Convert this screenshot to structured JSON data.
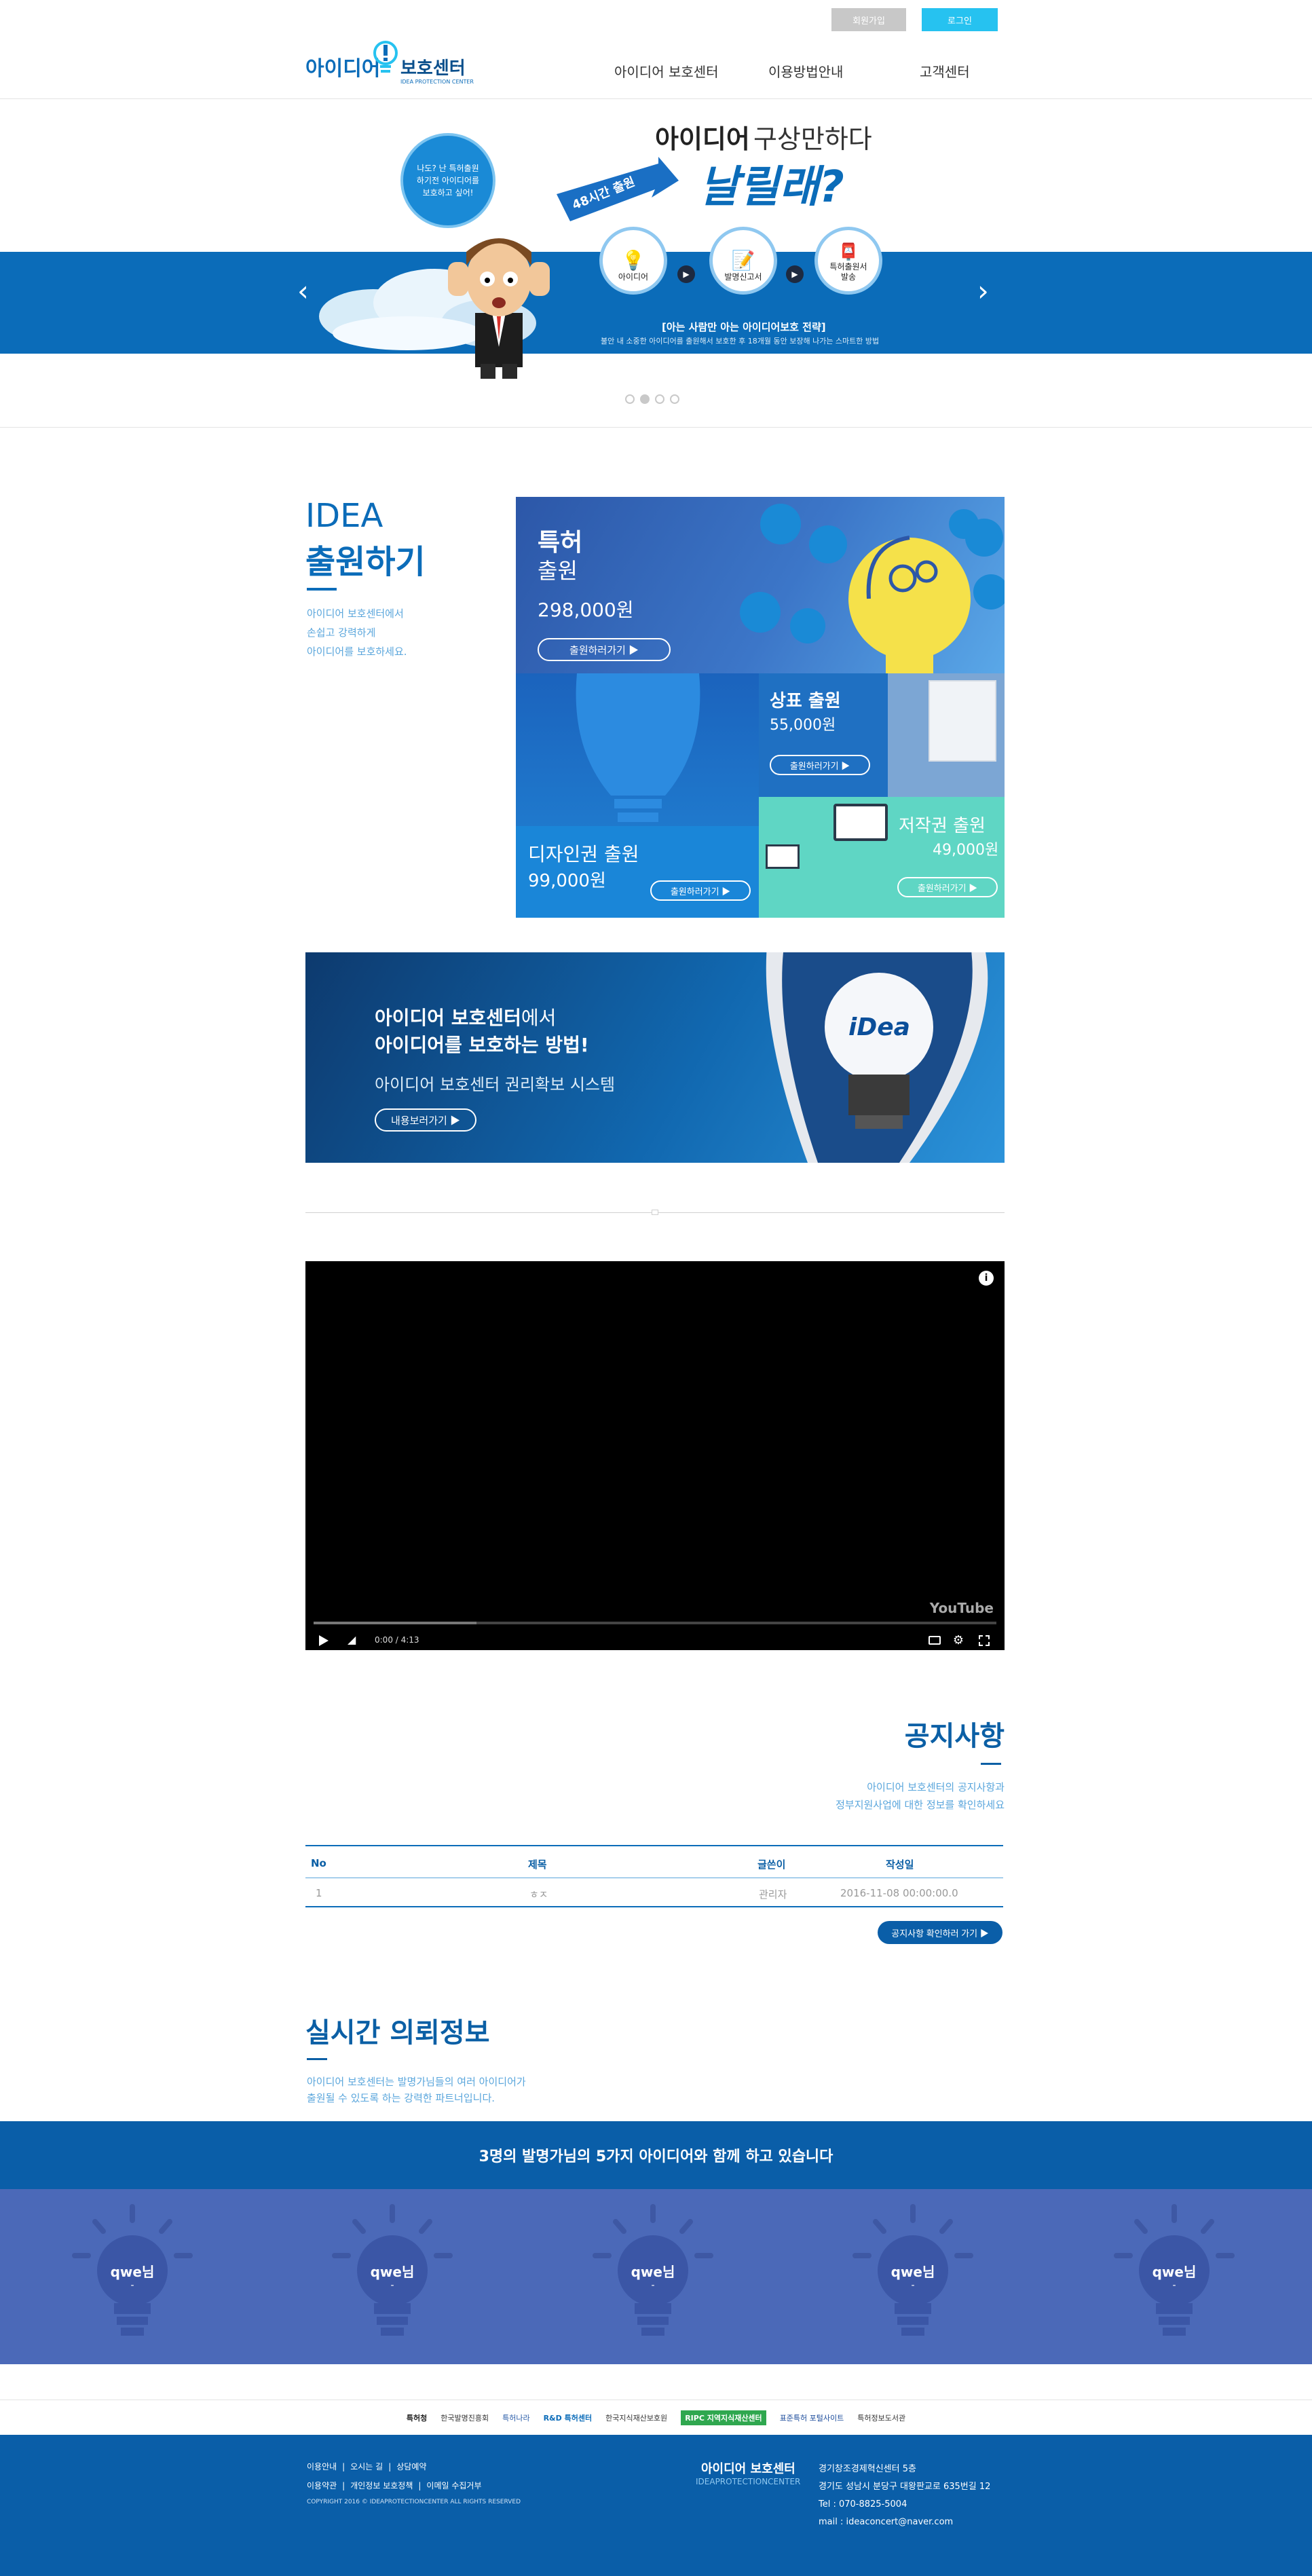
{
  "header": {
    "logo": {
      "main_text": "아이디어",
      "brand_text": "보호센터",
      "sub_text": "IDEA PROTECTION CENTER"
    },
    "signup_label": "회원가입",
    "login_label": "로그인",
    "nav": [
      "아이디어 보호센터",
      "이용방법안내",
      "고객센터"
    ]
  },
  "hero": {
    "headline_bold": "아이디어",
    "headline_rest": "구상만하다",
    "headline_big": "날릴래?",
    "bubble_text": "나도? 난 특허출원하기전 아이디어를 보호하고 싶어!",
    "banner_text": "48시간 출원",
    "steps": [
      "아이디어",
      "발명신고서",
      "특허출원서 발송"
    ],
    "caption_main": "[아는 사람만 아는 아이디어보호 전략]",
    "caption_sub": "불안 내 소중한 아이디어를 출원해서 보호한 후 18개월 동안 보장해 나가는 스마트한 방법",
    "dots_total": 4,
    "dots_active_index": 1,
    "prev_icon": "chevron-left-icon",
    "next_icon": "chevron-right-icon"
  },
  "apply": {
    "heading_en": "IDEA",
    "heading_ko": "출원하기",
    "description": [
      "아이디어 보호센터에서",
      "손쉽고 강력하게",
      "아이디어를 보호하세요."
    ],
    "tiles": {
      "patent": {
        "title": "특허",
        "sub": "출원",
        "price": "298,000원",
        "button": "출원하러가기 ▶"
      },
      "trademark": {
        "title": "상표 출원",
        "price": "55,000원",
        "button": "출원하러가기 ▶"
      },
      "design": {
        "title": "디자인권 출원",
        "price": "99,000원",
        "button": "출원하러가기 ▶"
      },
      "copyright": {
        "title": "저작권 출원",
        "price": "49,000원",
        "button": "출원하러가기 ▶"
      }
    }
  },
  "protect_banner": {
    "line1_bold": "아이디어 보호센터",
    "line1_rest": "에서",
    "line2": "아이디어를 보호하는 방법!",
    "line3": "아이디어 보호센터 권리확보 시스템",
    "button": "내용보러가기 ▶",
    "bulb_text": "iDea"
  },
  "video": {
    "time": "0:00 / 4:13",
    "brand": "YouTube",
    "progress": 0.0
  },
  "notice": {
    "title": "공지사항",
    "description": [
      "아이디어 보호센터의 공지사항과",
      "정부지원사업에 대한 정보를 확인하세요"
    ],
    "columns": [
      "No",
      "제목",
      "글쓴이",
      "작성일"
    ],
    "rows": [
      {
        "no": "1",
        "title": "ㅎㅈ",
        "author": "관리자",
        "date": "2016-11-08 00:00:00.0"
      }
    ],
    "button": "공지사항 확인하러 가기 ▶"
  },
  "realtime": {
    "title": "실시간 의뢰정보",
    "description": [
      "아이디어 보호센터는 발명가님들의 여러 아이디어가",
      "출원될 수 있도록 하는 강력한 파트너입니다."
    ],
    "banner": "3명의 발명가님의 5가지 아이디어와 함께 하고 있습니다",
    "bulbs": [
      {
        "name": "qwe님",
        "sub": "-"
      },
      {
        "name": "qwe님",
        "sub": "-"
      },
      {
        "name": "qwe님",
        "sub": "-"
      },
      {
        "name": "qwe님",
        "sub": "-"
      },
      {
        "name": "qwe님",
        "sub": "-"
      }
    ]
  },
  "partners": [
    "특허청",
    "한국발명진흥회",
    "특허나라",
    "R&D 특허센터",
    "한국지식재산보호원",
    "RIPC 지역지식재산센터",
    "표준특허 포털사이트",
    "특허정보도서관"
  ],
  "footer": {
    "links_row1": [
      "이용안내",
      "오시는 길",
      "상담예약"
    ],
    "links_row2": [
      "이용약관",
      "개인정보 보호정책",
      "이메일 수집거부"
    ],
    "copyright": "COPYRIGHT 2016 © IDEAPROTECTIONCENTER ALL RIGHTS RESERVED",
    "brand_ko": "아이디어 보호센터",
    "brand_en": "IDEAPROTECTIONCENTER",
    "address1": "경기창조경제혁신센터 5층",
    "address2": "경기도 성남시 분당구 대왕판교로 635번길 12",
    "tel": "Tel : 070-8825-5004",
    "mail": "mail : ideaconcert@naver.com"
  },
  "colors": {
    "brand_blue": "#0b6cb9",
    "dark_blue": "#0a4f8c",
    "footer_blue": "#0a5ea8",
    "light_blue_text": "#5aa6dc",
    "signup_gray": "#c8c8c8",
    "login_cyan": "#26c2f0"
  }
}
